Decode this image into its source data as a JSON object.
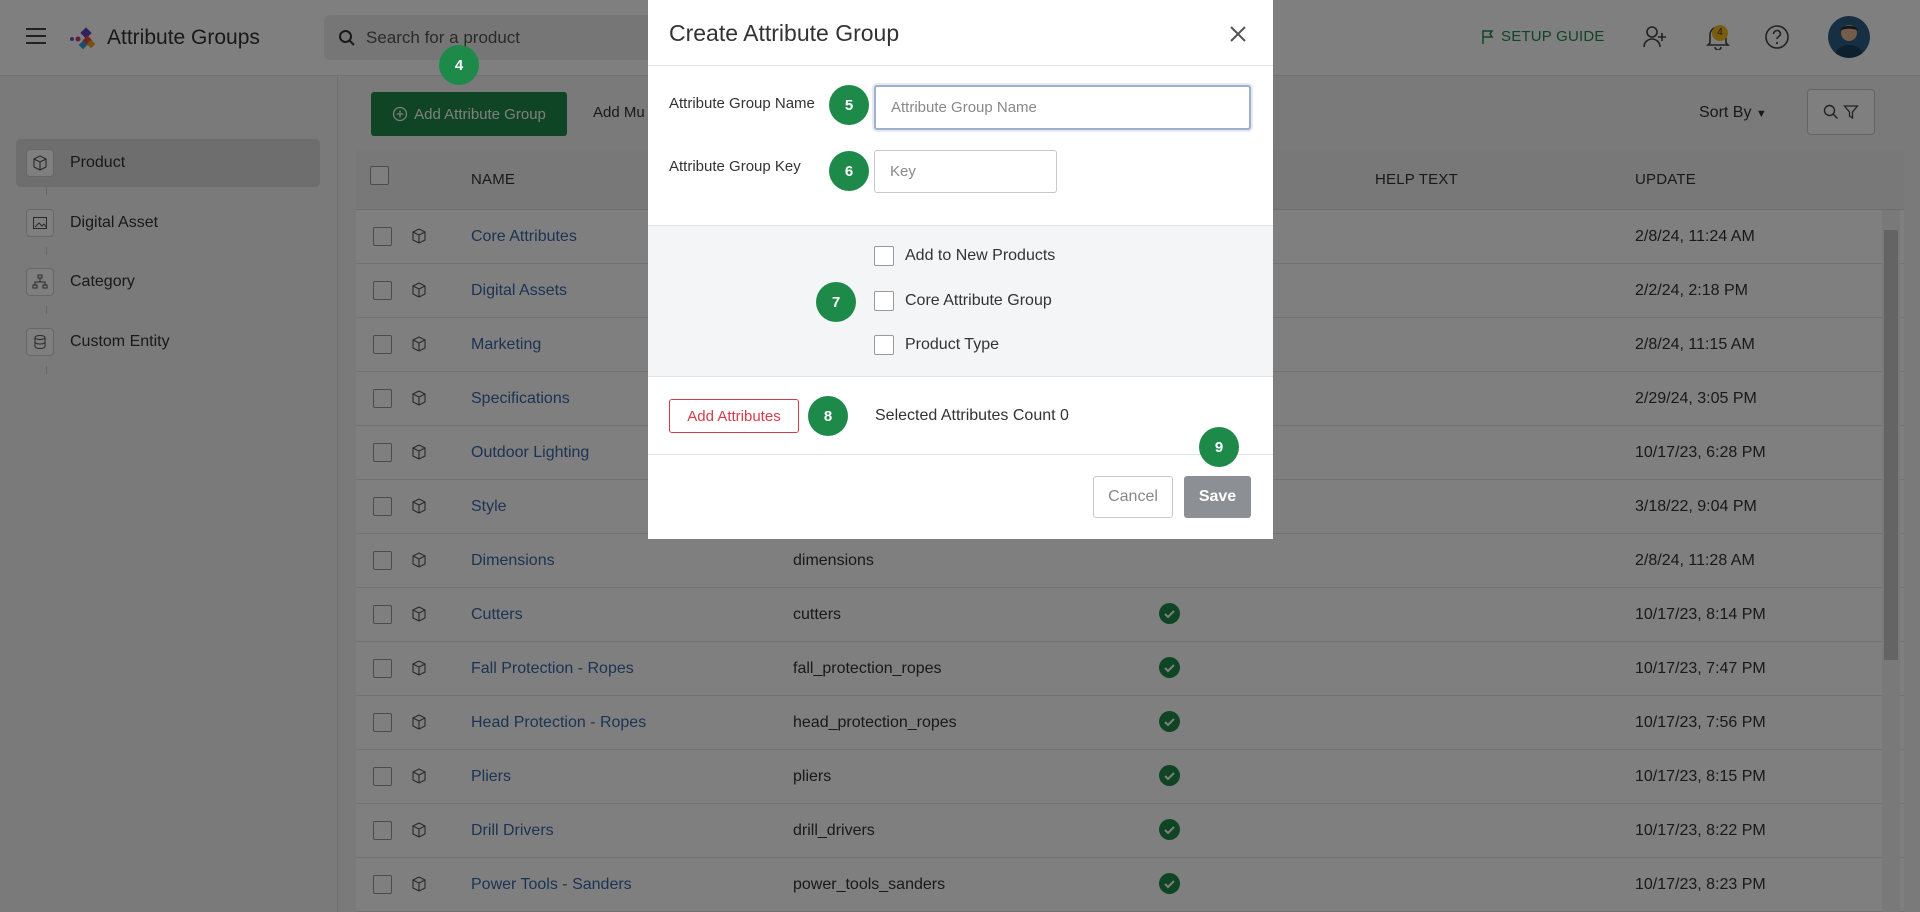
{
  "header": {
    "title": "Attribute Groups",
    "search_placeholder": "Search for a product",
    "setup_guide": "SETUP GUIDE",
    "notification_count": "4"
  },
  "sidebar": {
    "items": [
      {
        "label": "Product",
        "icon": "cube-icon",
        "active": true
      },
      {
        "label": "Digital Asset",
        "icon": "image-icon"
      },
      {
        "label": "Category",
        "icon": "hierarchy-icon"
      },
      {
        "label": "Custom Entity",
        "icon": "database-icon"
      }
    ]
  },
  "toolbar": {
    "add_label": "Add Attribute Group",
    "add_multiple_label": "Add Mu",
    "sort_label": "Sort By"
  },
  "table": {
    "columns": [
      "NAME",
      "HELP TEXT",
      "UPDATE"
    ],
    "rows": [
      {
        "name": "Core Attributes",
        "key": "",
        "check": false,
        "update": "2/8/24, 11:24 AM"
      },
      {
        "name": "Digital Assets",
        "key": "",
        "check": false,
        "update": "2/2/24, 2:18 PM"
      },
      {
        "name": "Marketing",
        "key": "",
        "check": false,
        "update": "2/8/24, 11:15 AM"
      },
      {
        "name": "Specifications",
        "key": "",
        "check": false,
        "update": "2/29/24, 3:05 PM"
      },
      {
        "name": "Outdoor Lighting",
        "key": "",
        "check": false,
        "update": "10/17/23, 6:28 PM"
      },
      {
        "name": "Style",
        "key": "",
        "check": false,
        "update": "3/18/22, 9:04 PM"
      },
      {
        "name": "Dimensions",
        "key": "dimensions",
        "check": false,
        "update": "2/8/24, 11:28 AM"
      },
      {
        "name": "Cutters",
        "key": "cutters",
        "check": true,
        "update": "10/17/23, 8:14 PM"
      },
      {
        "name": "Fall Protection - Ropes",
        "key": "fall_protection_ropes",
        "check": true,
        "update": "10/17/23, 7:47 PM"
      },
      {
        "name": "Head Protection - Ropes",
        "key": "head_protection_ropes",
        "check": true,
        "update": "10/17/23, 7:56 PM"
      },
      {
        "name": "Pliers",
        "key": "pliers",
        "check": true,
        "update": "10/17/23, 8:15 PM"
      },
      {
        "name": "Drill Drivers",
        "key": "drill_drivers",
        "check": true,
        "update": "10/17/23, 8:22 PM"
      },
      {
        "name": "Power Tools - Sanders",
        "key": "power_tools_sanders",
        "check": true,
        "update": "10/17/23, 8:23 PM"
      }
    ]
  },
  "modal": {
    "title": "Create Attribute Group",
    "name_label": "Attribute Group Name",
    "name_placeholder": "Attribute Group Name",
    "key_label": "Attribute Group Key",
    "key_placeholder": "Key",
    "options": [
      "Add to New Products",
      "Core Attribute Group",
      "Product Type"
    ],
    "add_attributes_label": "Add Attributes",
    "selected_count_text": "Selected Attributes Count 0",
    "cancel_label": "Cancel",
    "save_label": "Save"
  },
  "steps": [
    "4",
    "5",
    "6",
    "7",
    "8",
    "9"
  ],
  "colors": {
    "brand_green": "#1e8a49",
    "link_blue": "#3a66a8",
    "danger_red": "#d63b4a",
    "disabled_gray": "#8c8f94"
  }
}
